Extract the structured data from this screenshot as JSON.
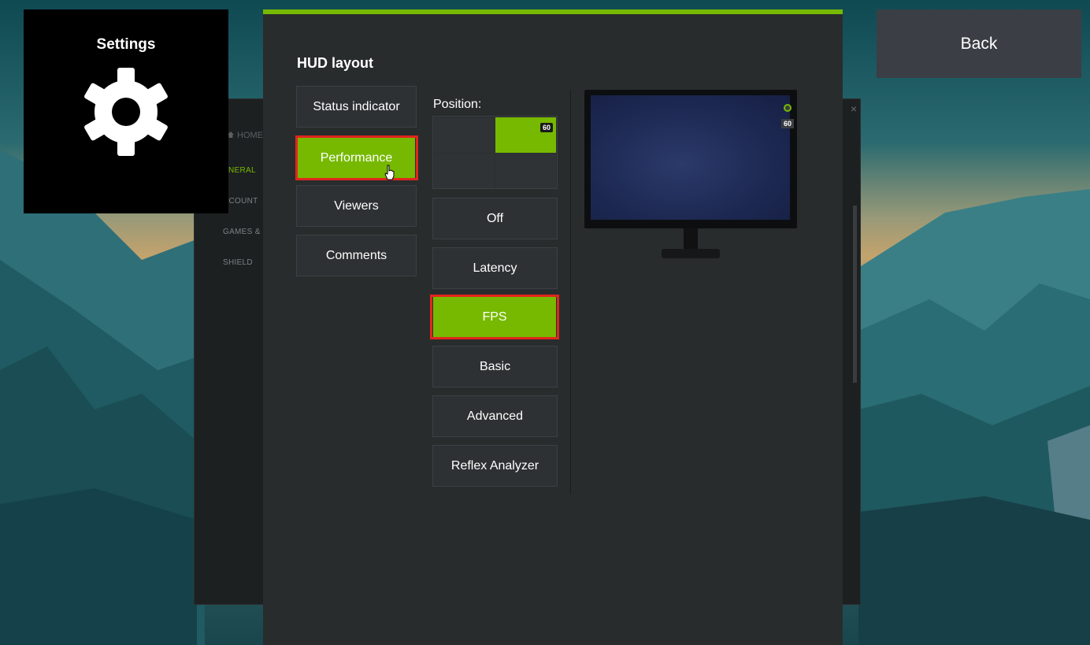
{
  "settings_tile": {
    "title": "Settings",
    "icon": "gear-icon"
  },
  "back_button": {
    "label": "Back"
  },
  "background_window": {
    "home_label": "HOME",
    "sidebar": [
      {
        "label": "ENERAL",
        "active": true
      },
      {
        "label": "CCOUNT",
        "active": false
      },
      {
        "label": "GAMES &",
        "active": false
      },
      {
        "label": "SHIELD",
        "active": false
      }
    ],
    "close_icon": "×"
  },
  "hud": {
    "title": "HUD layout",
    "categories": [
      {
        "label": "Status indicator",
        "selected": false
      },
      {
        "label": "Performance",
        "selected": true
      },
      {
        "label": "Viewers",
        "selected": false
      },
      {
        "label": "Comments",
        "selected": false
      }
    ],
    "position_label": "Position:",
    "position_grid": {
      "selected_cell": "top-right",
      "badge": "60"
    },
    "modes": [
      {
        "label": "Off",
        "selected": false
      },
      {
        "label": "Latency",
        "selected": false
      },
      {
        "label": "FPS",
        "selected": true
      },
      {
        "label": "Basic",
        "selected": false
      },
      {
        "label": "Advanced",
        "selected": false
      },
      {
        "label": "Reflex Analyzer",
        "selected": false
      }
    ],
    "preview": {
      "fps_badge": "60"
    }
  },
  "colors": {
    "accent": "#76b900",
    "highlight": "#e0261d",
    "panel": "#292c2d"
  }
}
